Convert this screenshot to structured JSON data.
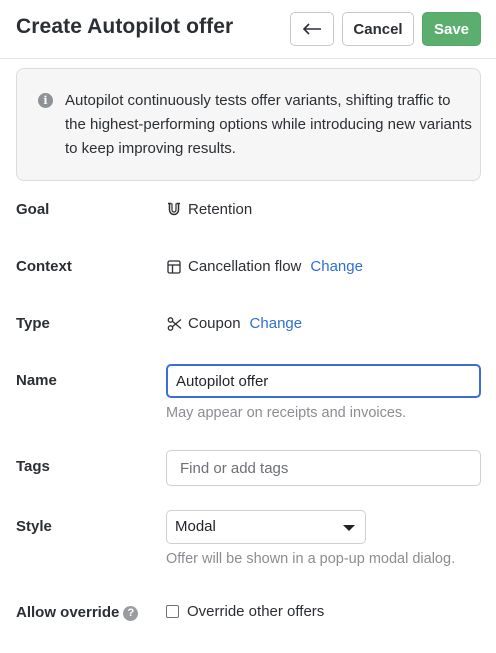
{
  "header": {
    "title": "Create Autopilot offer",
    "back_icon": "arrow-left-icon",
    "back_glyph": "←",
    "cancel_label": "Cancel",
    "save_label": "Save"
  },
  "info": {
    "icon": "info-icon",
    "icon_glyph": "i",
    "text": "Autopilot continuously tests offer variants, shifting traffic to the highest-performing options while introducing new variants to keep improving results."
  },
  "fields": {
    "goal": {
      "label": "Goal",
      "icon": "magnet-icon",
      "value": "Retention"
    },
    "context": {
      "label": "Context",
      "icon": "layout-icon",
      "value": "Cancellation flow",
      "change_label": "Change"
    },
    "type": {
      "label": "Type",
      "icon": "scissors-icon",
      "value": "Coupon",
      "change_label": "Change"
    },
    "name": {
      "label": "Name",
      "value": "Autopilot offer",
      "help": "May appear on receipts and invoices."
    },
    "tags": {
      "label": "Tags",
      "placeholder": "Find or add tags"
    },
    "style": {
      "label": "Style",
      "selected": "Modal",
      "help": "Offer will be shown in a pop-up modal dialog."
    },
    "override": {
      "label": "Allow override",
      "help_icon": "question-icon",
      "help_glyph": "?",
      "checkbox_label": "Override other offers",
      "checked": false
    }
  },
  "colors": {
    "primary": "#5cae6f",
    "link": "#2f6fd4",
    "focus": "#3b6fd6"
  }
}
